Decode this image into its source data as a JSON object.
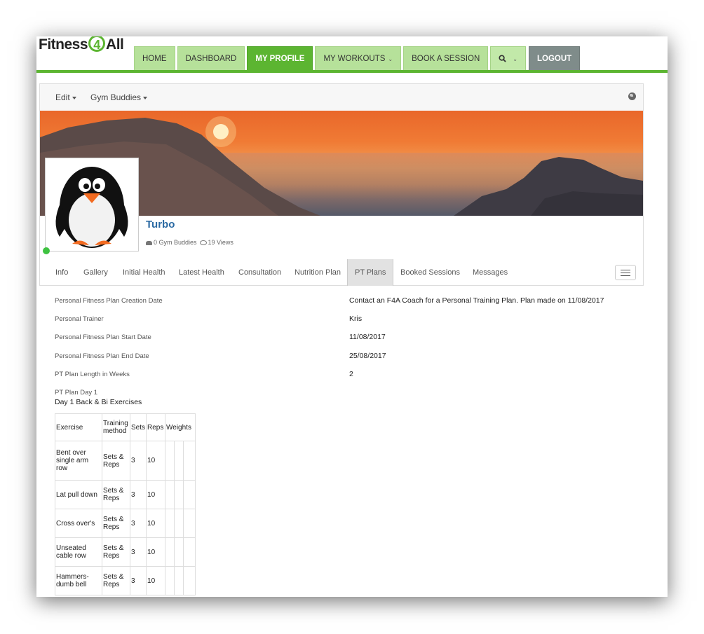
{
  "logo": {
    "part1": "Fitness",
    "part2": "4",
    "part3": "All"
  },
  "nav": {
    "home": "HOME",
    "dashboard": "DASHBOARD",
    "my_profile": "MY PROFILE",
    "my_workouts": "MY WORKOUTS",
    "book_session": "BOOK A SESSION",
    "logout": "LOGOUT"
  },
  "toolbar": {
    "edit": "Edit",
    "gym_buddies": "Gym Buddies"
  },
  "profile": {
    "name": "Turbo",
    "buddies": "0 Gym Buddies",
    "views": "19 Views"
  },
  "tabs": [
    "Info",
    "Gallery",
    "Initial Health",
    "Latest Health",
    "Consultation",
    "Nutrition Plan",
    "PT Plans",
    "Booked Sessions",
    "Messages"
  ],
  "fields": [
    {
      "label": "Personal Fitness Plan Creation Date",
      "value": "Contact an F4A Coach for a Personal Training Plan. Plan made on 11/08/2017"
    },
    {
      "label": "Personal Trainer",
      "value": "Kris"
    },
    {
      "label": "Personal Fitness Plan Start Date",
      "value": "11/08/2017"
    },
    {
      "label": "Personal Fitness Plan End Date",
      "value": "25/08/2017"
    },
    {
      "label": "PT Plan Length in Weeks",
      "value": "2"
    }
  ],
  "day": {
    "label": "PT Plan Day 1",
    "title": "Day 1 Back & Bi Exercises"
  },
  "table": {
    "headers": [
      "Exercise",
      "Training method",
      "Sets",
      "Reps",
      "Weights"
    ],
    "rows": [
      {
        "exercise": "Bent over single arm row",
        "method": "Sets & Reps",
        "sets": "3",
        "reps": "10"
      },
      {
        "exercise": "Lat pull down",
        "method": "Sets & Reps",
        "sets": "3",
        "reps": "10"
      },
      {
        "exercise": "Cross over's",
        "method": "Sets & Reps",
        "sets": "3",
        "reps": "10"
      },
      {
        "exercise": "Unseated cable row",
        "method": "Sets & Reps",
        "sets": "3",
        "reps": "10"
      },
      {
        "exercise": "Hammers-dumb bell",
        "method": "Sets & Reps",
        "sets": "3",
        "reps": "10"
      }
    ]
  },
  "colors": {
    "brand_green": "#5cb531",
    "nav_tab": "#b6e19a",
    "logout": "#7f8c8a",
    "name_blue": "#2b6aa3",
    "online": "#3ec241"
  }
}
